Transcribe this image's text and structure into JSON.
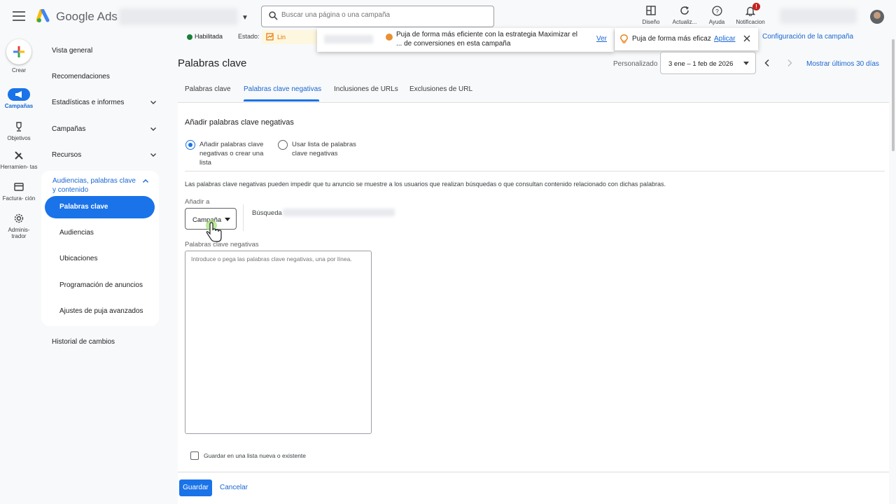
{
  "app": {
    "brand": "Google Ads"
  },
  "search": {
    "placeholder": "Buscar una página o una campaña"
  },
  "toolbar": {
    "design": "Diseño",
    "refresh": "Actualiz...",
    "help": "Ayuda",
    "notifications": "Notificacion",
    "notifications_badge": "!"
  },
  "rail": {
    "create": "Crear",
    "campaigns": "Campañas",
    "goals": "Objetivos",
    "tools": "Herramien- tas",
    "billing": "Factura- ción",
    "admin": "Adminis- trador"
  },
  "nav": {
    "overview": "Vista general",
    "recommendations": "Recomendaciones",
    "insights": "Estadísticas e informes",
    "campaigns": "Campañas",
    "assets": "Recursos",
    "group_title": "Audiencias, palabras clave y contenido",
    "sub": [
      "Palabras clave",
      "Audiencias",
      "Ubicaciones",
      "Programación de anuncios",
      "Ajustes de puja avanzados"
    ],
    "change_history": "Historial de cambios"
  },
  "status": {
    "enabled": "Habilitada",
    "estado_label": "Estado:",
    "estado_value": "Lin",
    "campaign_settings": "Configuración de la campaña"
  },
  "reco": {
    "text": "Puja de forma más eficiente con la estrategia Maximizar el ... de conversiones en esta campaña",
    "link": "Ver"
  },
  "tip": {
    "text": "Puja de forma más eficaz",
    "link": "Aplicar"
  },
  "header": {
    "title": "Palabras clave",
    "date_mode": "Personalizado",
    "date_range": "3 ene – 1 feb de 2026",
    "show_last": "Mostrar últimos 30 días"
  },
  "tabs": [
    "Palabras clave",
    "Palabras clave negativas",
    "Inclusiones de URLs",
    "Exclusiones de URL"
  ],
  "form": {
    "title": "Añadir palabras clave negativas",
    "option_1": "Añadir palabras clave negativas o crear una lista",
    "option_2": "Usar lista de palabras clave negativas",
    "description": "Las palabras clave negativas pueden impedir que tu anuncio se muestre a los usuarios que realizan búsquedas o que consultan contenido relacionado con dichas palabras.",
    "add_to_label": "Añadir a",
    "add_to_value": "Campaña",
    "search_label": "Búsqueda",
    "negatives_label": "Palabras clave negativas",
    "negatives_placeholder": "Introduce o pega las palabras clave negativas, una por línea.",
    "save_list_label": "Guardar en una lista nueva o existente"
  },
  "footer": {
    "save": "Guardar",
    "cancel": "Cancelar"
  },
  "colors": {
    "accent": "#1a73e8",
    "link": "#1967d2",
    "enabled": "#188038",
    "warning": "#e37400",
    "alert": "#c5221f"
  }
}
